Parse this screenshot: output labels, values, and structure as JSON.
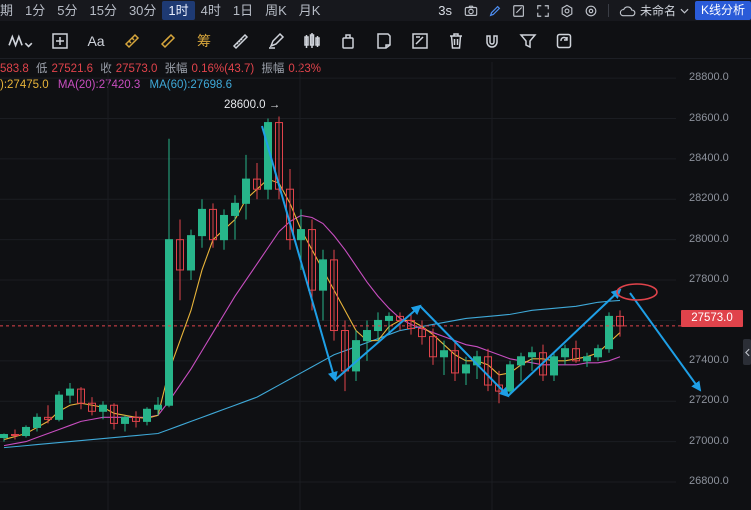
{
  "topbar": {
    "cut_label": "期",
    "timeframes": [
      {
        "label": "1分"
      },
      {
        "label": "5分"
      },
      {
        "label": "15分"
      },
      {
        "label": "30分"
      },
      {
        "label": "1时",
        "active": true
      },
      {
        "label": "4时"
      },
      {
        "label": "1日"
      },
      {
        "label": "周K"
      },
      {
        "label": "月K"
      }
    ],
    "interval": "3s",
    "layout_name": "未命名",
    "analysis_button": "K线分析"
  },
  "toolbar": {
    "text_tool": "Aa",
    "chip_tool": "筹"
  },
  "info": {
    "high_partial": "583.8",
    "low_label": "低",
    "low": "27521.6",
    "close_label": "收",
    "close": "27573.0",
    "chg_label": "张幅",
    "chg": "0.16%(43.7)",
    "amp_label": "振幅",
    "amp": "0.23%"
  },
  "ma": {
    "ma5": "):27475.0",
    "ma20_label": "MA(20):",
    "ma20": "27420.3",
    "ma60_label": "MA(60):",
    "ma60": "27698.6"
  },
  "colors": {
    "up": "#27b58a",
    "down": "#e0434b",
    "ma5": "#e8b43a",
    "ma20": "#c84ec0",
    "ma60": "#3fa9d8",
    "arrow": "#1e9fe6"
  },
  "price_axis": [
    "28800.0",
    "28600.0",
    "28400.0",
    "28200.0",
    "28000.0",
    "27800.0",
    "27600.0",
    "27400.0",
    "27200.0",
    "27000.0",
    "26800.0"
  ],
  "last_price": "27573.0",
  "annotation_high": "28600.0 →",
  "chart_data": {
    "type": "candlestick",
    "ylim": [
      26780,
      28880
    ],
    "candles": [
      [
        27020,
        27040,
        27000,
        27035
      ],
      [
        27035,
        27060,
        27010,
        27030
      ],
      [
        27030,
        27080,
        27020,
        27070
      ],
      [
        27070,
        27140,
        27050,
        27120
      ],
      [
        27120,
        27180,
        27090,
        27110
      ],
      [
        27110,
        27250,
        27100,
        27230
      ],
      [
        27230,
        27290,
        27190,
        27260
      ],
      [
        27260,
        27270,
        27160,
        27190
      ],
      [
        27190,
        27220,
        27130,
        27150
      ],
      [
        27150,
        27200,
        27110,
        27180
      ],
      [
        27180,
        27190,
        27060,
        27090
      ],
      [
        27090,
        27130,
        27050,
        27120
      ],
      [
        27120,
        27150,
        27070,
        27100
      ],
      [
        27100,
        27170,
        27080,
        27160
      ],
      [
        27160,
        27220,
        27130,
        27180
      ],
      [
        27180,
        28500,
        27170,
        28000
      ],
      [
        28000,
        28100,
        27700,
        27850
      ],
      [
        27850,
        28050,
        27800,
        28020
      ],
      [
        28020,
        28200,
        27960,
        28150
      ],
      [
        28150,
        28180,
        27960,
        28000
      ],
      [
        28000,
        28150,
        27950,
        28120
      ],
      [
        28120,
        28220,
        28000,
        28180
      ],
      [
        28180,
        28420,
        28100,
        28300
      ],
      [
        28300,
        28380,
        28200,
        28250
      ],
      [
        28250,
        28600,
        28200,
        28580
      ],
      [
        28580,
        28610,
        28200,
        28250
      ],
      [
        28250,
        28350,
        27950,
        28000
      ],
      [
        28000,
        28150,
        27850,
        28050
      ],
      [
        28050,
        28100,
        27650,
        27750
      ],
      [
        27750,
        27950,
        27600,
        27900
      ],
      [
        27900,
        27950,
        27500,
        27550
      ],
      [
        27550,
        27600,
        27250,
        27350
      ],
      [
        27350,
        27550,
        27300,
        27500
      ],
      [
        27500,
        27600,
        27400,
        27550
      ],
      [
        27550,
        27640,
        27500,
        27600
      ],
      [
        27600,
        27640,
        27540,
        27620
      ],
      [
        27620,
        27640,
        27550,
        27600
      ],
      [
        27600,
        27630,
        27530,
        27560
      ],
      [
        27560,
        27600,
        27480,
        27520
      ],
      [
        27520,
        27560,
        27380,
        27420
      ],
      [
        27420,
        27500,
        27330,
        27450
      ],
      [
        27450,
        27500,
        27300,
        27340
      ],
      [
        27340,
        27420,
        27280,
        27380
      ],
      [
        27380,
        27450,
        27310,
        27420
      ],
      [
        27420,
        27460,
        27250,
        27280
      ],
      [
        27280,
        27350,
        27190,
        27250
      ],
      [
        27250,
        27400,
        27230,
        27380
      ],
      [
        27380,
        27440,
        27300,
        27420
      ],
      [
        27420,
        27470,
        27350,
        27440
      ],
      [
        27440,
        27480,
        27300,
        27330
      ],
      [
        27330,
        27440,
        27300,
        27420
      ],
      [
        27420,
        27480,
        27380,
        27460
      ],
      [
        27460,
        27500,
        27390,
        27400
      ],
      [
        27400,
        27440,
        27370,
        27420
      ],
      [
        27420,
        27480,
        27400,
        27460
      ],
      [
        27460,
        27640,
        27440,
        27620
      ],
      [
        27620,
        27650,
        27520,
        27573
      ]
    ],
    "ma5": [
      27010,
      27025,
      27040,
      27070,
      27100,
      27150,
      27180,
      27190,
      27180,
      27170,
      27140,
      27130,
      27120,
      27115,
      27130,
      27350,
      27500,
      27650,
      27850,
      28000,
      28050,
      28100,
      28200,
      28250,
      28300,
      28280,
      28180,
      28050,
      27950,
      27850,
      27750,
      27650,
      27550,
      27500,
      27500,
      27570,
      27600,
      27600,
      27570,
      27530,
      27480,
      27430,
      27400,
      27400,
      27380,
      27330,
      27340,
      27380,
      27410,
      27410,
      27400,
      27400,
      27410,
      27420,
      27440,
      27490,
      27540
    ],
    "ma20": [
      26980,
      26990,
      27000,
      27020,
      27040,
      27060,
      27080,
      27100,
      27110,
      27120,
      27120,
      27120,
      27120,
      27120,
      27130,
      27200,
      27280,
      27360,
      27450,
      27540,
      27630,
      27720,
      27800,
      27880,
      27960,
      28040,
      28090,
      28120,
      28110,
      28080,
      28020,
      27950,
      27870,
      27790,
      27720,
      27660,
      27610,
      27580,
      27560,
      27540,
      27520,
      27500,
      27480,
      27470,
      27450,
      27430,
      27410,
      27400,
      27390,
      27380,
      27380,
      27380,
      27380,
      27390,
      27390,
      27400,
      27420
    ],
    "ma60": [
      26970,
      26975,
      26980,
      26985,
      26990,
      26995,
      27000,
      27005,
      27010,
      27015,
      27020,
      27025,
      27030,
      27035,
      27040,
      27060,
      27080,
      27100,
      27120,
      27140,
      27160,
      27180,
      27200,
      27220,
      27250,
      27280,
      27310,
      27340,
      27370,
      27400,
      27430,
      27450,
      27470,
      27490,
      27510,
      27530,
      27550,
      27560,
      27570,
      27580,
      27590,
      27600,
      27610,
      27615,
      27620,
      27625,
      27630,
      27640,
      27650,
      27655,
      27660,
      27665,
      27670,
      27680,
      27690,
      27695,
      27699
    ]
  }
}
